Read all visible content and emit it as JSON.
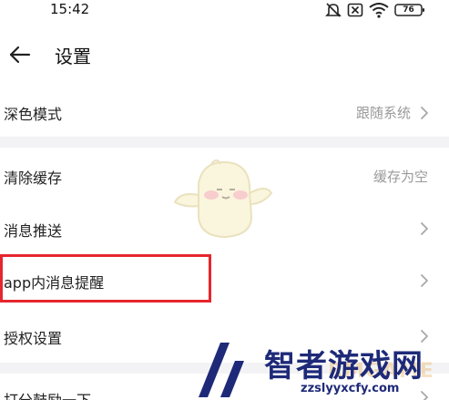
{
  "status_bar": {
    "time": "15:42",
    "battery": "76",
    "icons": [
      "mute-icon",
      "close-box-icon",
      "wifi-icon",
      "battery-icon"
    ]
  },
  "header": {
    "title": "设置",
    "back_icon": "back-arrow-icon"
  },
  "settings": {
    "dark_mode": {
      "label": "深色模式",
      "value": "跟随系统"
    },
    "clear_cache": {
      "label": "清除缓存",
      "value": "缓存为空"
    },
    "push": {
      "label": "消息推送"
    },
    "in_app_reminder": {
      "label": "app内消息提醒"
    },
    "authorization": {
      "label": "授权设置"
    },
    "rate": {
      "label": "打分鼓励一下"
    }
  },
  "watermark": {
    "site_name": "智者游戏网",
    "site_url": "zzslyyxcfy.com",
    "faint_text": "RMGAME"
  },
  "colors": {
    "highlight": "#e6262d",
    "separator": "#f3f3f5",
    "secondary_text": "#9a9a9a",
    "brand_blue": "#1e2a78"
  }
}
